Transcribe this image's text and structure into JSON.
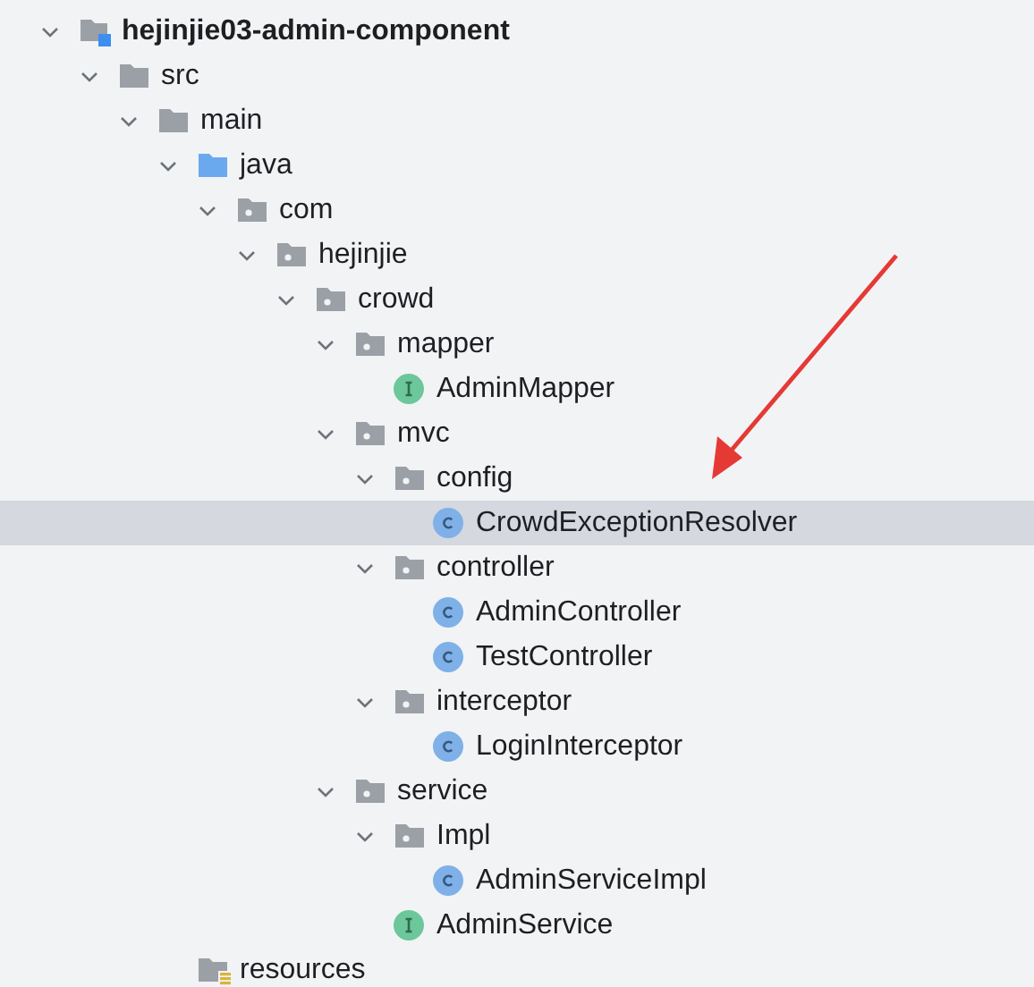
{
  "project_tree": [
    {
      "kind": "module",
      "label": "hejinjie03-admin-component",
      "expanded": true,
      "selected": false,
      "children": [
        {
          "kind": "folder",
          "label": "src",
          "expanded": true,
          "selected": false,
          "children": [
            {
              "kind": "folder",
              "label": "main",
              "expanded": true,
              "selected": false,
              "children": [
                {
                  "kind": "source",
                  "label": "java",
                  "expanded": true,
                  "selected": false,
                  "children": [
                    {
                      "kind": "package",
                      "label": "com",
                      "expanded": true,
                      "selected": false,
                      "children": [
                        {
                          "kind": "package",
                          "label": "hejinjie",
                          "expanded": true,
                          "selected": false,
                          "children": [
                            {
                              "kind": "package",
                              "label": "crowd",
                              "expanded": true,
                              "selected": false,
                              "children": [
                                {
                                  "kind": "package",
                                  "label": "mapper",
                                  "expanded": true,
                                  "selected": false,
                                  "children": [
                                    {
                                      "kind": "interface",
                                      "label": "AdminMapper",
                                      "selected": false
                                    }
                                  ]
                                },
                                {
                                  "kind": "package",
                                  "label": "mvc",
                                  "expanded": true,
                                  "selected": false,
                                  "children": [
                                    {
                                      "kind": "package",
                                      "label": "config",
                                      "expanded": true,
                                      "selected": false,
                                      "children": [
                                        {
                                          "kind": "class",
                                          "label": "CrowdExceptionResolver",
                                          "selected": true
                                        }
                                      ]
                                    },
                                    {
                                      "kind": "package",
                                      "label": "controller",
                                      "expanded": true,
                                      "selected": false,
                                      "children": [
                                        {
                                          "kind": "class",
                                          "label": "AdminController",
                                          "selected": false
                                        },
                                        {
                                          "kind": "class",
                                          "label": "TestController",
                                          "selected": false
                                        }
                                      ]
                                    },
                                    {
                                      "kind": "package",
                                      "label": "interceptor",
                                      "expanded": true,
                                      "selected": false,
                                      "children": [
                                        {
                                          "kind": "class",
                                          "label": "LoginInterceptor",
                                          "selected": false
                                        }
                                      ]
                                    }
                                  ]
                                },
                                {
                                  "kind": "package",
                                  "label": "service",
                                  "expanded": true,
                                  "selected": false,
                                  "children": [
                                    {
                                      "kind": "package",
                                      "label": "Impl",
                                      "expanded": true,
                                      "selected": false,
                                      "children": [
                                        {
                                          "kind": "class",
                                          "label": "AdminServiceImpl",
                                          "selected": false
                                        }
                                      ]
                                    },
                                    {
                                      "kind": "interface",
                                      "label": "AdminService",
                                      "selected": false
                                    }
                                  ]
                                }
                              ]
                            }
                          ]
                        }
                      ]
                    }
                  ]
                },
                {
                  "kind": "resources",
                  "label": "resources",
                  "selected": false
                }
              ]
            }
          ]
        }
      ]
    }
  ]
}
